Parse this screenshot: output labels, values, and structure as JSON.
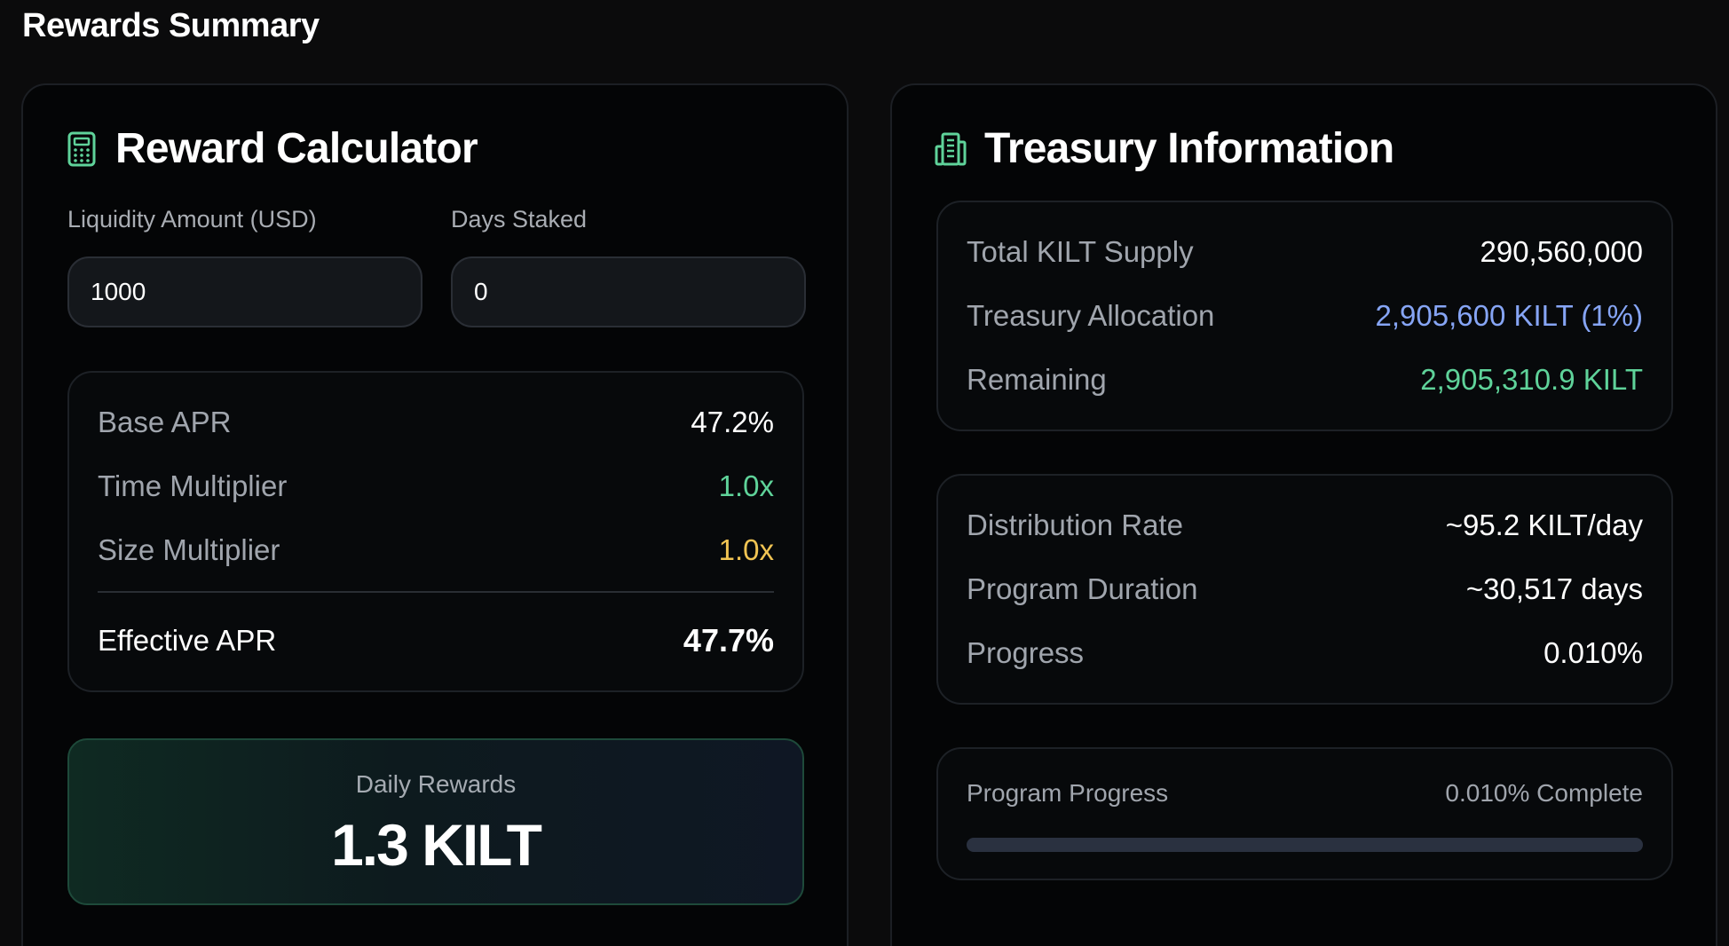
{
  "page": {
    "title": "Rewards Summary"
  },
  "calculator": {
    "title": "Reward Calculator",
    "icon": "calculator-icon",
    "liquidity_label": "Liquidity Amount (USD)",
    "liquidity_value": "1000",
    "days_label": "Days Staked",
    "days_value": "0",
    "stats": {
      "base_apr_label": "Base APR",
      "base_apr_value": "47.2%",
      "time_mult_label": "Time Multiplier",
      "time_mult_value": "1.0x",
      "size_mult_label": "Size Multiplier",
      "size_mult_value": "1.0x",
      "effective_apr_label": "Effective APR",
      "effective_apr_value": "47.7%"
    },
    "daily_rewards_label": "Daily Rewards",
    "daily_rewards_value": "1.3 KILT"
  },
  "treasury": {
    "title": "Treasury Information",
    "icon": "building-icon",
    "supply": {
      "total_supply_label": "Total KILT Supply",
      "total_supply_value": "290,560,000",
      "allocation_label": "Treasury Allocation",
      "allocation_value": "2,905,600 KILT (1%)",
      "remaining_label": "Remaining",
      "remaining_value": "2,905,310.9 KILT"
    },
    "distribution": {
      "rate_label": "Distribution Rate",
      "rate_value": "~95.2 KILT/day",
      "duration_label": "Program Duration",
      "duration_value": "~30,517 days",
      "progress_label": "Progress",
      "progress_value": "0.010%"
    },
    "program_progress": {
      "label": "Program Progress",
      "status": "0.010% Complete",
      "fraction": 0.0001
    }
  },
  "colors": {
    "accent_green": "#5fd39a",
    "accent_yellow": "#f1c453",
    "accent_blue": "#86a5f5"
  }
}
